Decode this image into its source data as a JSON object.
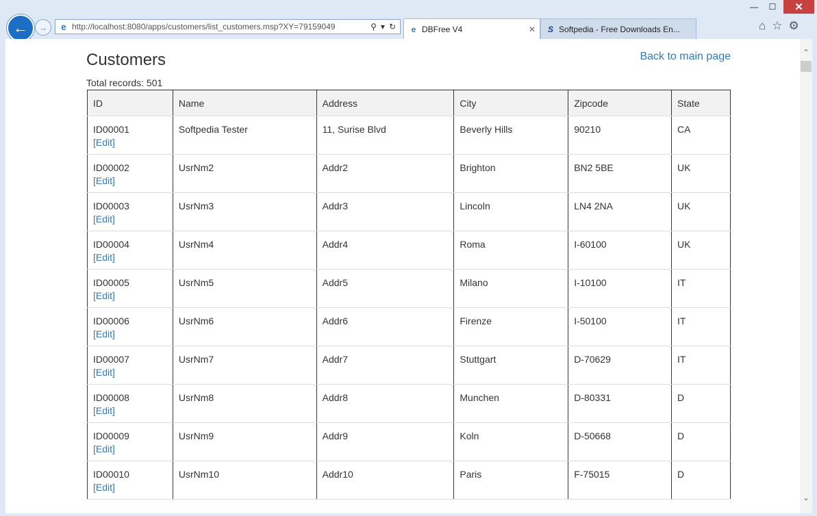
{
  "browser": {
    "url": "http://localhost:8080/apps/customers/list_customers.msp?XY=79159049",
    "tabs": [
      {
        "title": "DBFree V4",
        "active": true
      },
      {
        "title": "Softpedia - Free Downloads En...",
        "active": false
      }
    ],
    "window_buttons": {
      "minimize": "—",
      "maximize": "☐",
      "close": "✕"
    }
  },
  "page": {
    "title": "Customers",
    "back_link": "Back to main page",
    "total_records": "Total records: 501",
    "columns": [
      "ID",
      "Name",
      "Address",
      "City",
      "Zipcode",
      "State"
    ],
    "edit_label": "[Edit]",
    "rows": [
      {
        "id": "ID00001",
        "name": "Softpedia Tester",
        "address": "11, Surise Blvd",
        "city": "Beverly Hills",
        "zipcode": "90210",
        "state": "CA"
      },
      {
        "id": "ID00002",
        "name": "UsrNm2",
        "address": "Addr2",
        "city": "Brighton",
        "zipcode": "BN2 5BE",
        "state": "UK"
      },
      {
        "id": "ID00003",
        "name": "UsrNm3",
        "address": "Addr3",
        "city": "Lincoln",
        "zipcode": "LN4 2NA",
        "state": "UK"
      },
      {
        "id": "ID00004",
        "name": "UsrNm4",
        "address": "Addr4",
        "city": "Roma",
        "zipcode": "I-60100",
        "state": "UK"
      },
      {
        "id": "ID00005",
        "name": "UsrNm5",
        "address": "Addr5",
        "city": "Milano",
        "zipcode": "I-10100",
        "state": "IT"
      },
      {
        "id": "ID00006",
        "name": "UsrNm6",
        "address": "Addr6",
        "city": "Firenze",
        "zipcode": "I-50100",
        "state": "IT"
      },
      {
        "id": "ID00007",
        "name": "UsrNm7",
        "address": "Addr7",
        "city": "Stuttgart",
        "zipcode": "D-70629",
        "state": "IT"
      },
      {
        "id": "ID00008",
        "name": "UsrNm8",
        "address": "Addr8",
        "city": "Munchen",
        "zipcode": "D-80331",
        "state": "D"
      },
      {
        "id": "ID00009",
        "name": "UsrNm9",
        "address": "Addr9",
        "city": "Koln",
        "zipcode": "D-50668",
        "state": "D"
      },
      {
        "id": "ID00010",
        "name": "UsrNm10",
        "address": "Addr10",
        "city": "Paris",
        "zipcode": "F-75015",
        "state": "D"
      }
    ]
  }
}
